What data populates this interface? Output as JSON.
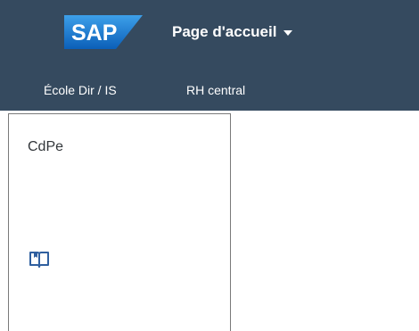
{
  "header": {
    "logo_text": "SAP",
    "page_title": "Page d'accueil",
    "dropdown_icon": "chevron-down-icon"
  },
  "tabs": [
    {
      "label": "École Dir / IS"
    },
    {
      "label": "RH central"
    }
  ],
  "tile": {
    "title": "CdPe",
    "icon": "book-icon"
  },
  "colors": {
    "shell_bg": "#354a5f",
    "logo_blue": "#1f78d1",
    "text_dark": "#32363a",
    "icon_blue": "#2f5f9f"
  }
}
